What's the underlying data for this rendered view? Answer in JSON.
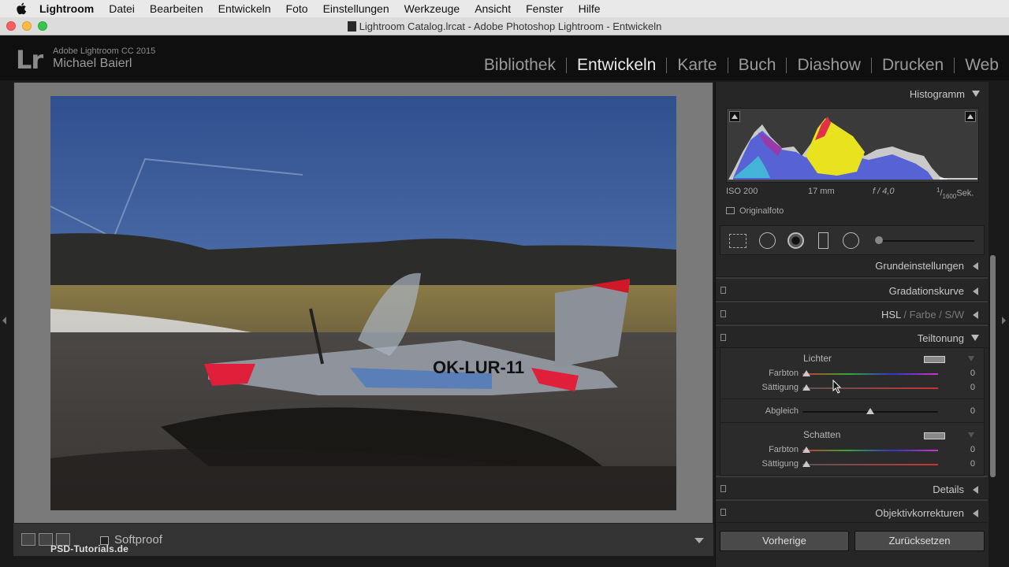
{
  "menubar": {
    "items": [
      "Lightroom",
      "Datei",
      "Bearbeiten",
      "Entwickeln",
      "Foto",
      "Einstellungen",
      "Werkzeuge",
      "Ansicht",
      "Fenster",
      "Hilfe"
    ]
  },
  "window": {
    "title": "Lightroom Catalog.lrcat - Adobe Photoshop Lightroom - Entwickeln"
  },
  "identity": {
    "logo": "Lr",
    "product": "Adobe Lightroom CC 2015",
    "user": "Michael Baierl"
  },
  "modules": [
    "Bibliothek",
    "Entwickeln",
    "Karte",
    "Buch",
    "Diashow",
    "Drucken",
    "Web"
  ],
  "active_module": "Entwickeln",
  "histogram": {
    "title": "Histogramm",
    "iso": "ISO 200",
    "focal": "17 mm",
    "aperture": "f / 4,0",
    "shutter_num": "1",
    "shutter_den": "1600",
    "shutter_unit": "Sek.",
    "original_label": "Originalfoto"
  },
  "panels": {
    "basic": "Grundeinstellungen",
    "tone_curve": "Gradationskurve",
    "hsl": "HSL",
    "color": "Farbe",
    "bw": "S/W",
    "split": "Teiltonung",
    "details": "Details",
    "lens": "Objektivkorrekturen"
  },
  "split_toning": {
    "highlights_label": "Lichter",
    "hue_label": "Farbton",
    "sat_label": "Sättigung",
    "balance_label": "Abgleich",
    "shadows_label": "Schatten",
    "highlights_hue": "0",
    "highlights_sat": "0",
    "balance": "0",
    "shadows_hue": "0",
    "shadows_sat": "0",
    "balance_position": 0.5
  },
  "buttons": {
    "previous": "Vorherige",
    "reset": "Zurücksetzen"
  },
  "toolbar": {
    "softproof": "Softproof",
    "watermark": "PSD-Tutorials.de"
  },
  "photo": {
    "registration": "OK-LUR-11"
  },
  "colors": {
    "accent_text": "#e8e8e8",
    "panel_bg": "#262626",
    "sky": "#4a6aa8"
  }
}
